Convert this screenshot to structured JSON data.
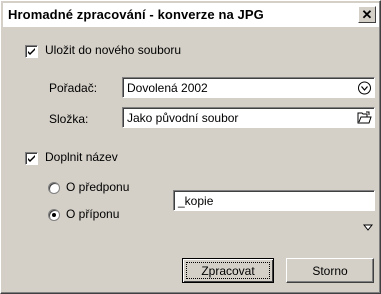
{
  "dialog": {
    "title": "Hromadné zpracování - konverze na JPG",
    "close_glyph": "✕"
  },
  "save_new": {
    "checked": true,
    "label": "Uložit do nového souboru",
    "folder_label": "Pořadač:",
    "folder_value": "Dovolená 2002",
    "dir_label": "Složka:",
    "dir_value": "Jako původní soubor"
  },
  "append_name": {
    "checked": true,
    "label": "Doplnit název",
    "option_prefix": "O předponu",
    "option_suffix": "O příponu",
    "selected": "suffix",
    "value": "_kopie"
  },
  "buttons": {
    "process": "Zpracovat",
    "cancel": "Storno"
  }
}
